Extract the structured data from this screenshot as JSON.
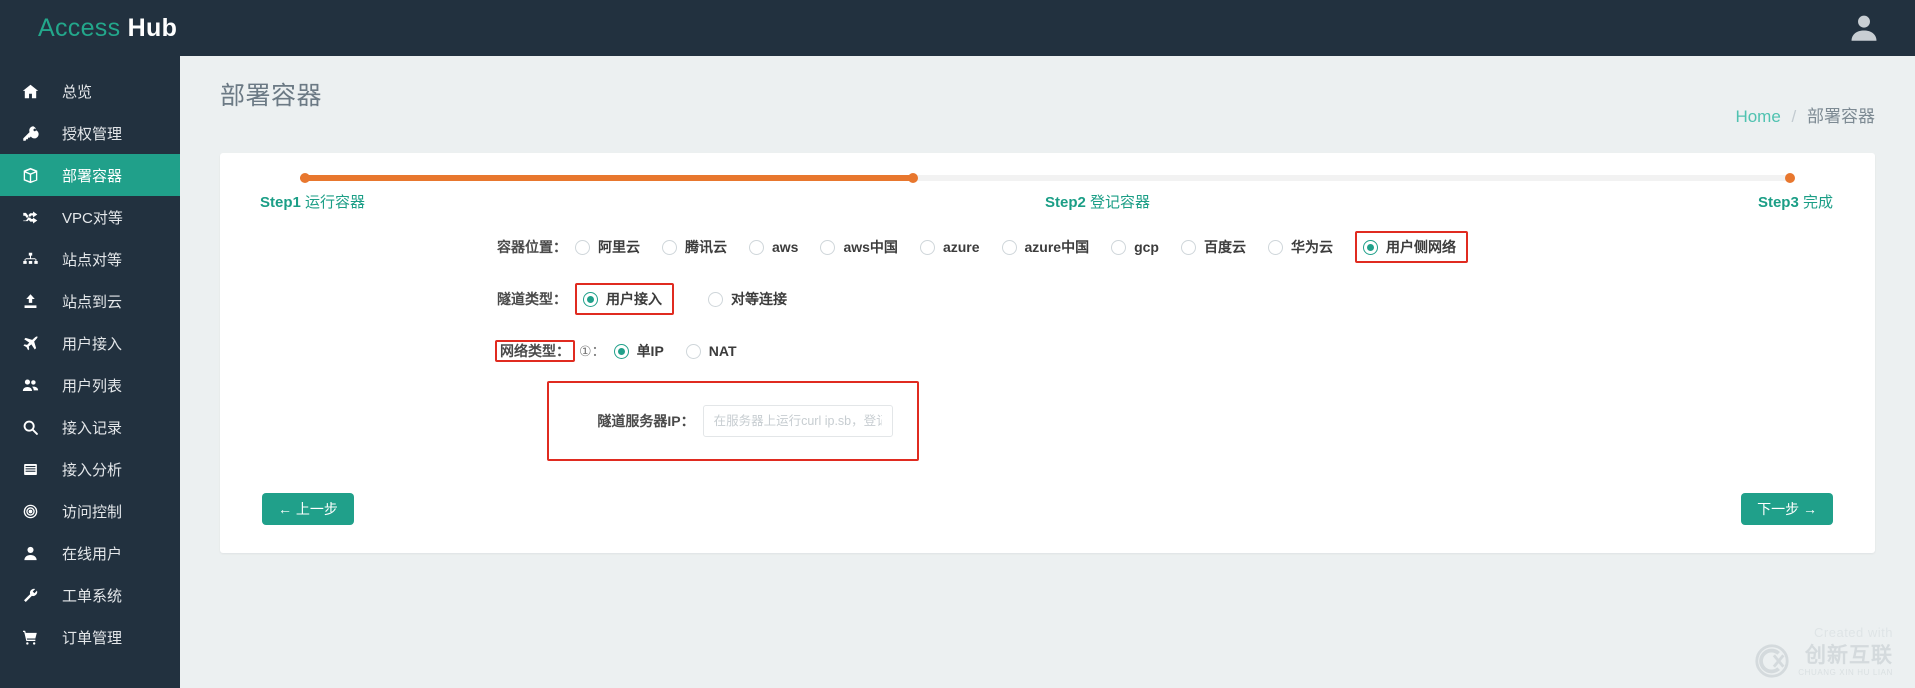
{
  "app": {
    "logo_primary": "Access",
    "logo_secondary": "Hub",
    "avatar_icon": "user-avatar-icon",
    "accent_color": "#20a08a",
    "topbar_color": "#22313f",
    "highlight_color": "#e02b20",
    "progress_color": "#e8772e"
  },
  "sidebar": {
    "items": [
      {
        "label": "总览",
        "icon": "home-icon",
        "active": false
      },
      {
        "label": "授权管理",
        "icon": "key-icon",
        "active": false
      },
      {
        "label": "部署容器",
        "icon": "box-icon",
        "active": true
      },
      {
        "label": "VPC对等",
        "icon": "shuffle-icon",
        "active": false
      },
      {
        "label": "站点对等",
        "icon": "sitemap-icon",
        "active": false
      },
      {
        "label": "站点到云",
        "icon": "upload-icon",
        "active": false
      },
      {
        "label": "用户接入",
        "icon": "plane-icon",
        "active": false
      },
      {
        "label": "用户列表",
        "icon": "users-icon",
        "active": false
      },
      {
        "label": "接入记录",
        "icon": "search-icon",
        "active": false
      },
      {
        "label": "接入分析",
        "icon": "list-icon",
        "active": false
      },
      {
        "label": "访问控制",
        "icon": "target-icon",
        "active": false
      },
      {
        "label": "在线用户",
        "icon": "user-icon",
        "active": false
      },
      {
        "label": "工单系统",
        "icon": "wrench-icon",
        "active": false
      },
      {
        "label": "订单管理",
        "icon": "cart-icon",
        "active": false
      }
    ]
  },
  "page": {
    "title": "部署容器",
    "breadcrumb_home": "Home",
    "breadcrumb_separator": "/",
    "breadcrumb_current": "部署容器"
  },
  "steps": {
    "progress_percent": 41,
    "items": [
      {
        "num": "Step1",
        "name": "运行容器"
      },
      {
        "num": "Step2",
        "name": "登记容器"
      },
      {
        "num": "Step3",
        "name": "完成"
      }
    ]
  },
  "form": {
    "location": {
      "label": "容器位置：",
      "options": [
        {
          "label": "阿里云",
          "selected": false,
          "highlighted": false
        },
        {
          "label": "腾讯云",
          "selected": false,
          "highlighted": false
        },
        {
          "label": "aws",
          "selected": false,
          "highlighted": false
        },
        {
          "label": "aws中国",
          "selected": false,
          "highlighted": false
        },
        {
          "label": "azure",
          "selected": false,
          "highlighted": false
        },
        {
          "label": "azure中国",
          "selected": false,
          "highlighted": false
        },
        {
          "label": "gcp",
          "selected": false,
          "highlighted": false
        },
        {
          "label": "百度云",
          "selected": false,
          "highlighted": false
        },
        {
          "label": "华为云",
          "selected": false,
          "highlighted": false
        },
        {
          "label": "用户侧网络",
          "selected": true,
          "highlighted": true
        }
      ]
    },
    "tunnel_type": {
      "label": "隧道类型：",
      "options": [
        {
          "label": "用户接入",
          "selected": true,
          "highlighted": true
        },
        {
          "label": "对等连接",
          "selected": false,
          "highlighted": false
        }
      ]
    },
    "network_type": {
      "label": "网络类型：",
      "label_highlighted": true,
      "hint": "①：",
      "options": [
        {
          "label": "单IP",
          "selected": true,
          "highlighted": false
        },
        {
          "label": "NAT",
          "selected": false,
          "highlighted": false
        }
      ]
    },
    "tunnel_server_ip": {
      "label": "隧道服务器IP：",
      "placeholder": "在服务器上运行curl ip.sb，登记该IP",
      "value": ""
    }
  },
  "actions": {
    "prev_label": "← 上一步",
    "next_label": "下一步 →"
  },
  "watermark": {
    "created_with": "Created with",
    "brand_cn": "创新互联",
    "brand_py": "CHUANG XIN HU LIAN"
  }
}
